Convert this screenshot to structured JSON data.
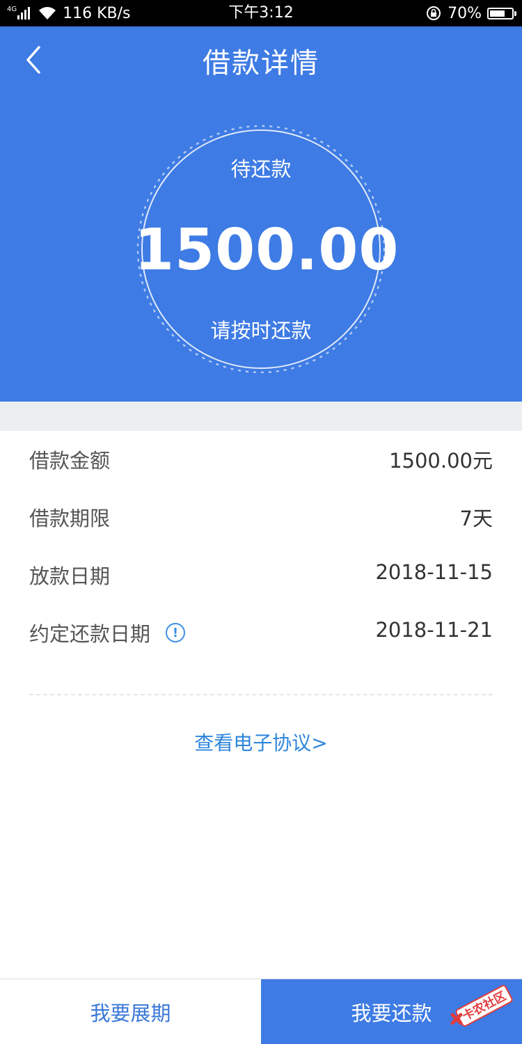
{
  "status_bar": {
    "network_tag": "4G",
    "speed": "116 KB/s",
    "time": "下午3:12",
    "battery_text": "70%",
    "battery_level": 0.7,
    "icons": [
      "signal-icon",
      "wifi-icon",
      "rotation-lock-icon",
      "battery-icon"
    ]
  },
  "header": {
    "title": "借款详情",
    "back_icon": "chevron-left-icon",
    "background_color": "#3e7be4"
  },
  "repayment_status": {
    "status": "待还款",
    "amount": "1500.00",
    "hint": "请按时还款"
  },
  "details": [
    {
      "label": "借款金额",
      "value": "1500.00元"
    },
    {
      "label": "借款期限",
      "value": "7天"
    },
    {
      "label": "放款日期",
      "value": "2018-11-15"
    },
    {
      "label": "约定还款日期",
      "value": "2018-11-21",
      "info_icon": "info-icon"
    }
  ],
  "agreement_link": "查看电子协议>",
  "actions": {
    "extend_label": "我要展期",
    "repay_label": "我要还款"
  },
  "watermark": {
    "text": "卡农社区"
  },
  "colors": {
    "primary_blue": "#3e7be4",
    "link_blue": "#2f86db",
    "divider_gray": "#edeef2"
  }
}
